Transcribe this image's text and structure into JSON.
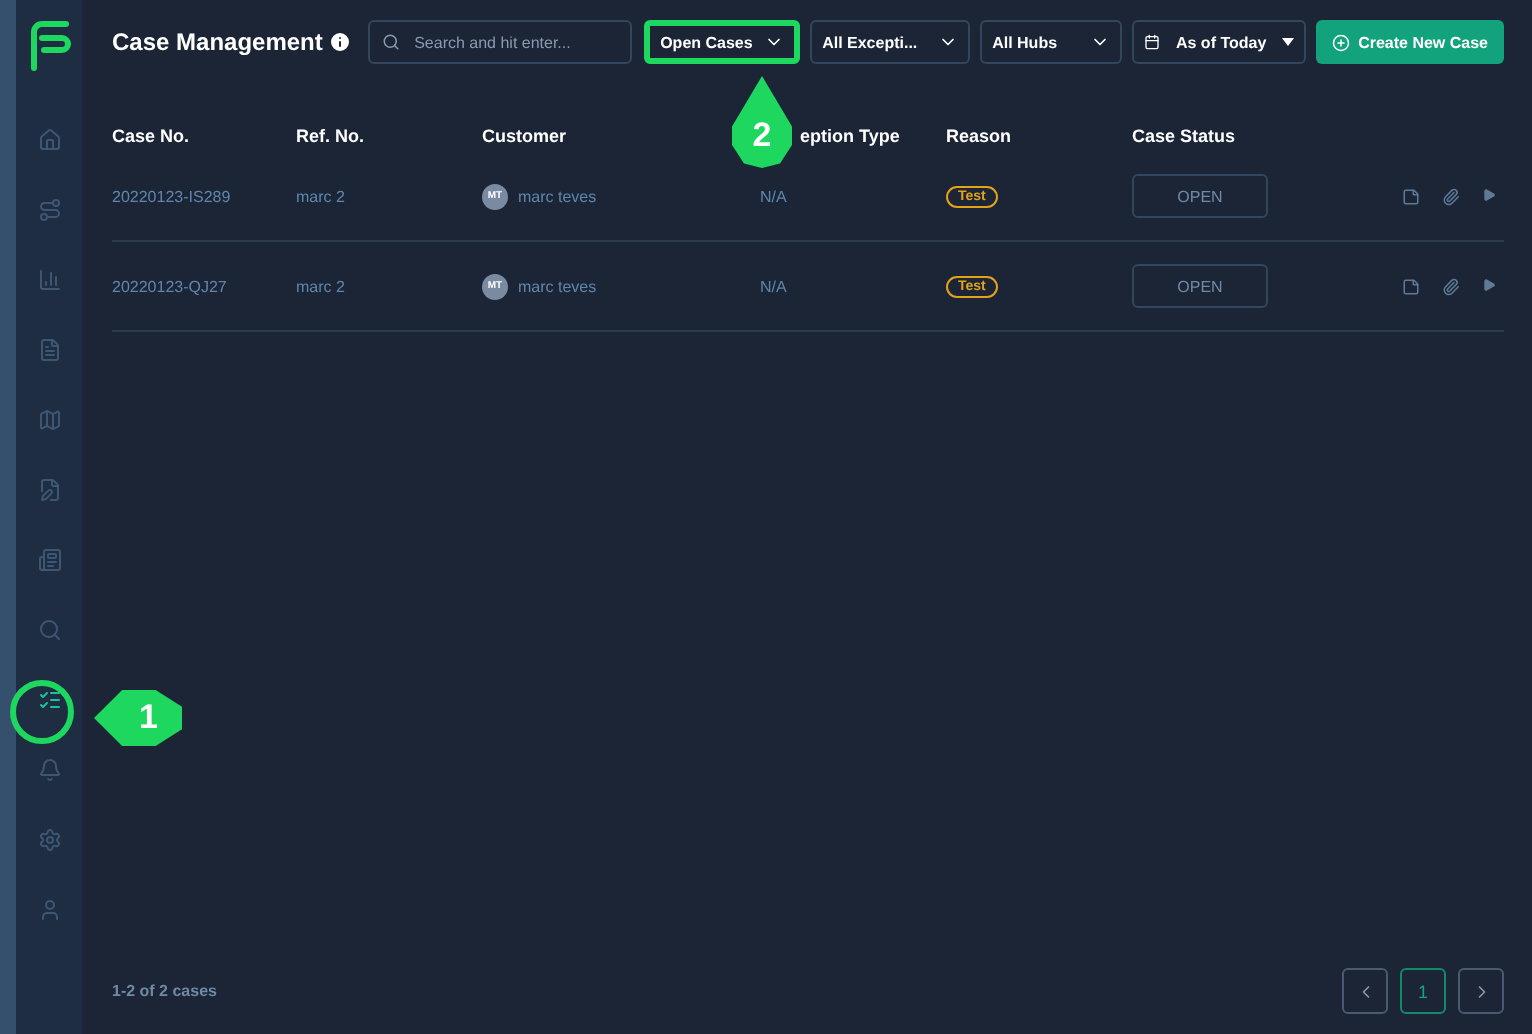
{
  "header": {
    "title": "Case Management",
    "search": {
      "placeholder": "Search and hit enter..."
    },
    "filters": [
      {
        "label": "Open Cases",
        "kind": "dropdown",
        "highlighted": true
      },
      {
        "label": "All Excepti...",
        "kind": "dropdown",
        "highlighted": false
      },
      {
        "label": "All Hubs",
        "kind": "dropdown",
        "highlighted": false
      },
      {
        "label": "As of Today",
        "kind": "date",
        "highlighted": false
      }
    ],
    "create_button": "Create New Case"
  },
  "sidebar": {
    "items": [
      {
        "selected": false
      },
      {
        "selected": false
      },
      {
        "selected": false
      },
      {
        "selected": false
      },
      {
        "selected": false
      },
      {
        "selected": false
      },
      {
        "selected": false
      },
      {
        "selected": false
      },
      {
        "selected": true
      },
      {
        "selected": false
      },
      {
        "selected": false
      },
      {
        "selected": false
      }
    ]
  },
  "table": {
    "columns": [
      "Case No.",
      "Ref. No.",
      "Customer",
      "eption Type",
      "Reason",
      "Case Status"
    ],
    "rows": [
      {
        "case_no": "20220123-IS289",
        "ref_no": "marc 2",
        "initials": "MT",
        "customer": "marc teves",
        "exception_type": "N/A",
        "reason": "Test",
        "status": "OPEN"
      },
      {
        "case_no": "20220123-QJ27",
        "ref_no": "marc 2",
        "initials": "MT",
        "customer": "marc teves",
        "exception_type": "N/A",
        "reason": "Test",
        "status": "OPEN"
      }
    ]
  },
  "footer": {
    "count": "1-2 of 2 cases",
    "pages": [
      {
        "label": "1",
        "selected": true
      }
    ]
  },
  "annotations": [
    {
      "label": "1"
    },
    {
      "label": "2"
    }
  ]
}
